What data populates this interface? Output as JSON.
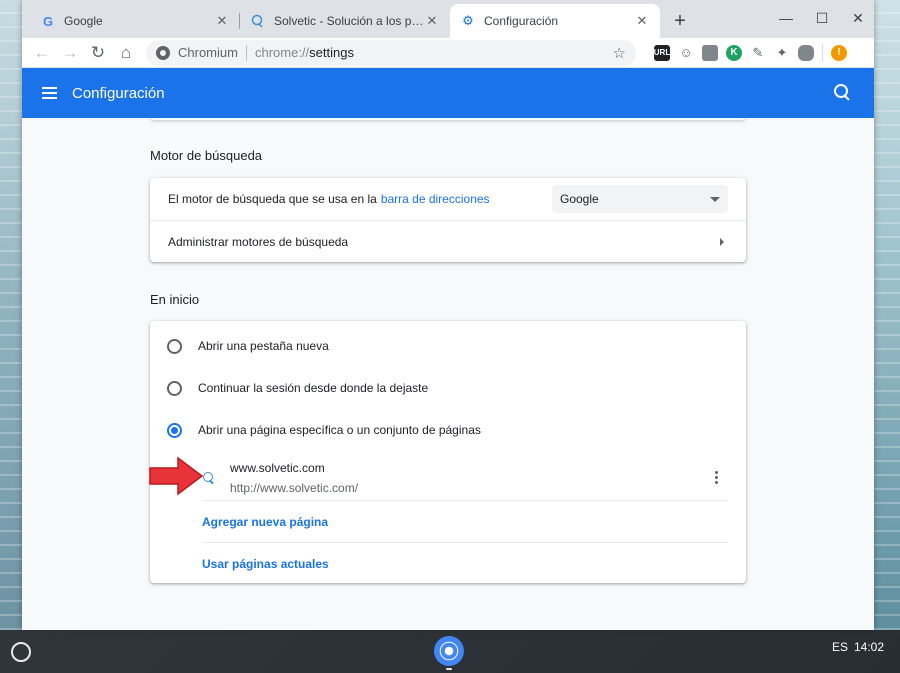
{
  "browser": {
    "tabs": [
      {
        "title": "Google",
        "favicon": "google-g-icon",
        "active": false
      },
      {
        "title": "Solvetic - Solución a los problem",
        "favicon": "solvetic-icon",
        "active": false
      },
      {
        "title": "Configuración",
        "favicon": "settings-gear-icon",
        "active": true
      }
    ],
    "new_tab_glyph": "+",
    "address": {
      "chip": "Chromium",
      "scheme": "chrome://",
      "path": "settings"
    },
    "extensions": [
      "url-ext-icon",
      "person-ext-icon",
      "tab-ext-icon",
      "k-ext-icon",
      "pen-ext-icon",
      "bulb-ext-icon",
      "vr-ext-icon",
      "alert-ext-icon"
    ],
    "ext_labels": {
      "url": "URL",
      "k": "K",
      "alert": "!"
    }
  },
  "settings": {
    "title": "Configuración",
    "search_engine": {
      "section_title": "Motor de búsqueda",
      "engine_label_prefix": "El motor de búsqueda que se usa en la",
      "engine_label_link": "barra de direcciones",
      "selected_engine": "Google",
      "manage_label": "Administrar motores de búsqueda"
    },
    "on_startup": {
      "section_title": "En inicio",
      "options": [
        {
          "label": "Abrir una pestaña nueva",
          "checked": false
        },
        {
          "label": "Continuar la sesión desde donde la dejaste",
          "checked": false
        },
        {
          "label": "Abrir una página específica o un conjunto de páginas",
          "checked": true
        }
      ],
      "pages": [
        {
          "name": "www.solvetic.com",
          "url": "http://www.solvetic.com/"
        }
      ],
      "add_page_label": "Agregar nueva página",
      "use_current_label": "Usar páginas actuales"
    }
  },
  "shelf": {
    "ime": "ES",
    "time": "14:02"
  },
  "colors": {
    "accent": "#1a73e8",
    "annotation_arrow": "#e8333a"
  }
}
